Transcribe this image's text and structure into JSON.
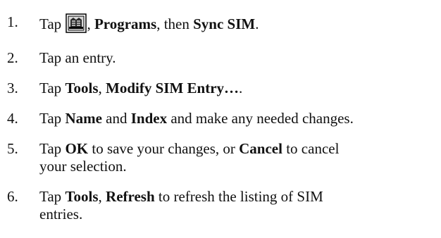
{
  "steps": [
    {
      "number": "1.",
      "tap": "Tap",
      "icon": "start-menu-icon",
      "comma": ",",
      "programs": "Programs",
      "then": ", then",
      "sync_sim": "Sync SIM",
      "end": "."
    },
    {
      "number": "2.",
      "text": "Tap an entry."
    },
    {
      "number": "3.",
      "tap": "Tap",
      "tools": "Tools",
      "comma": ",",
      "modify": "Modify SIM Entry…",
      "end": "."
    },
    {
      "number": "4.",
      "tap": "Tap",
      "name": "Name",
      "and": "and",
      "index": "Index",
      "rest": "and make any needed changes."
    },
    {
      "number": "5.",
      "tap": "Tap",
      "ok": "OK",
      "mid": "to save your changes, or",
      "cancel": "Cancel",
      "rest_line1": "to cancel",
      "rest_line2": "your selection."
    },
    {
      "number": "6.",
      "tap": "Tap",
      "tools": "Tools",
      "comma": ",",
      "refresh": "Refresh",
      "rest_line1": "to refresh the listing of SIM",
      "rest_line2": "entries."
    }
  ]
}
